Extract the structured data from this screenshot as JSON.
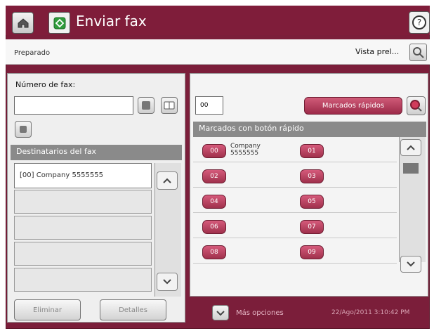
{
  "header": {
    "title": "Enviar fax",
    "home_icon": "home-icon",
    "fax_icon": "fax-icon",
    "help_icon": "help-icon"
  },
  "status": {
    "text": "Preparado",
    "preview_label": "Vista prel..."
  },
  "left": {
    "fax_number_label": "Número de fax:",
    "fax_number_value": "",
    "recipients_header": "Destinatarios del fax",
    "recipients": [
      "[00] Company 5555555"
    ],
    "delete_label": "Eliminar",
    "details_label": "Detalles"
  },
  "right": {
    "speed_input_value": "00",
    "speed_dials_label": "Marcados rápidos",
    "speed_header": "Marcados con botón rápido",
    "entries": [
      {
        "num": "00",
        "name": "Company",
        "number": "5555555"
      },
      {
        "num": "01",
        "name": "",
        "number": ""
      },
      {
        "num": "02",
        "name": "",
        "number": ""
      },
      {
        "num": "03",
        "name": "",
        "number": ""
      },
      {
        "num": "04",
        "name": "",
        "number": ""
      },
      {
        "num": "05",
        "name": "",
        "number": ""
      },
      {
        "num": "06",
        "name": "",
        "number": ""
      },
      {
        "num": "07",
        "name": "",
        "number": ""
      },
      {
        "num": "08",
        "name": "",
        "number": ""
      },
      {
        "num": "09",
        "name": "",
        "number": ""
      }
    ],
    "more_options": "Más opciones",
    "datetime": "22/Ago/2011 3:10:42 PM"
  },
  "colors": {
    "brand": "#7f1d3a",
    "accent": "#b63b5c"
  }
}
